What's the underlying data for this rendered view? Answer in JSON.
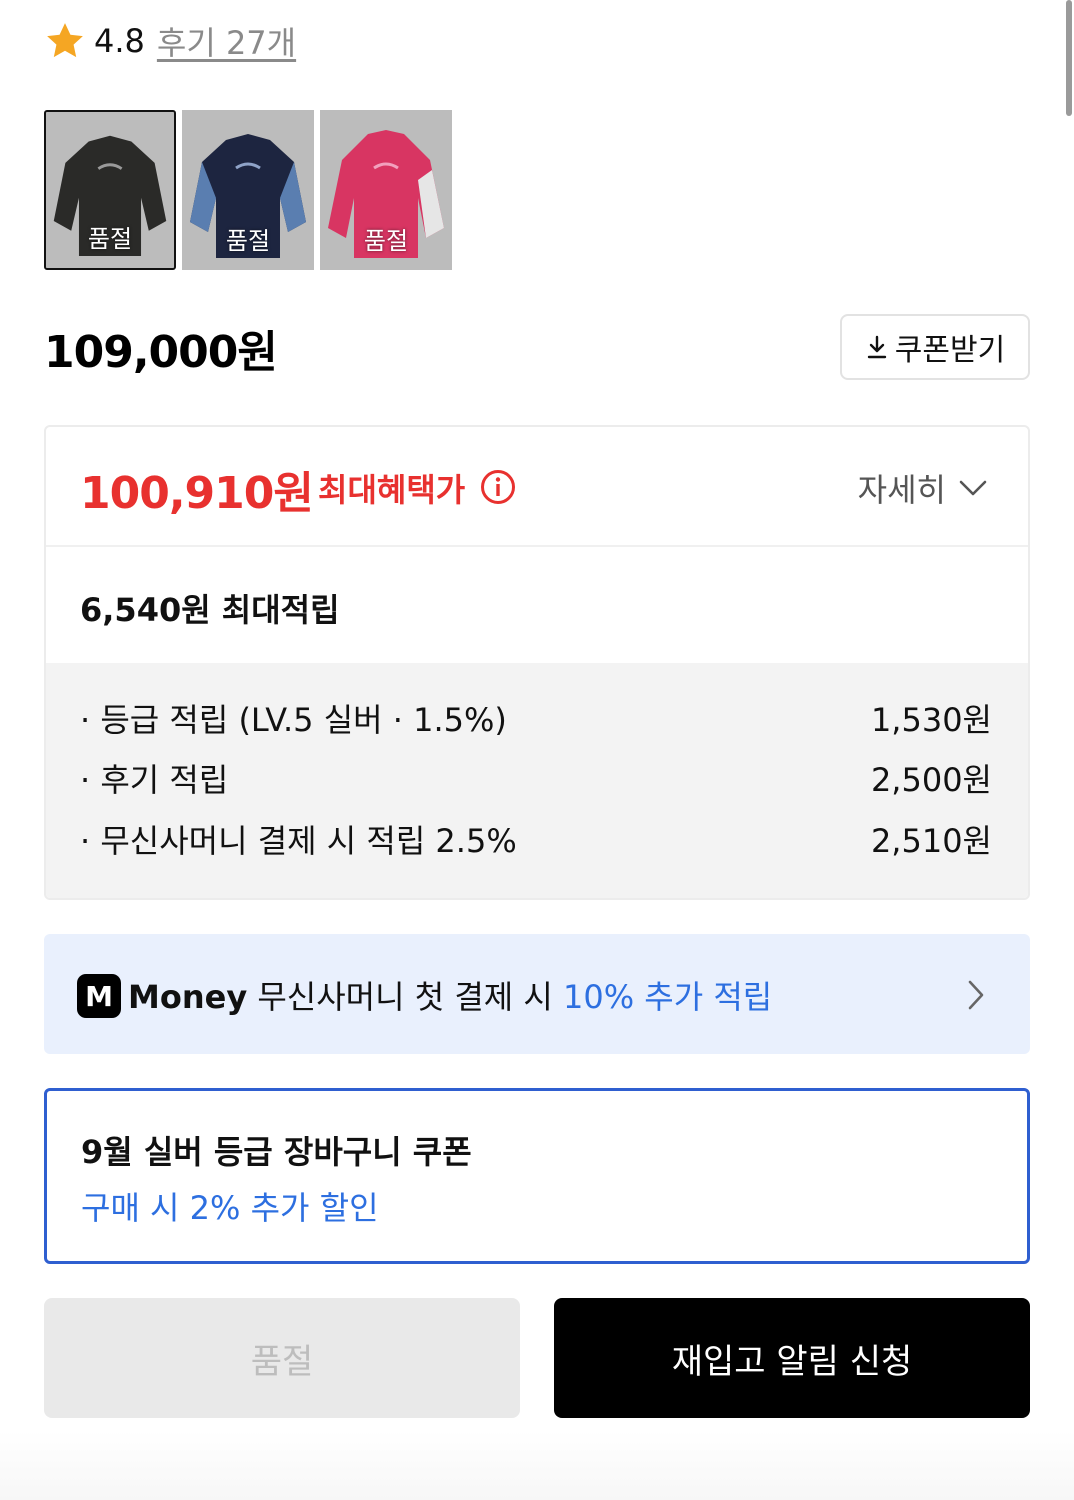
{
  "rating": {
    "score": "4.8",
    "review_link": "후기 27개",
    "star_color": "#f5a623"
  },
  "thumbnails": [
    {
      "label": "품절",
      "color": "black",
      "selected": true
    },
    {
      "label": "품절",
      "color": "navy",
      "selected": false
    },
    {
      "label": "품절",
      "color": "pink",
      "selected": false
    }
  ],
  "price": {
    "original": "109,000원",
    "coupon_button": "쿠폰받기",
    "coupon_icon": "download-icon"
  },
  "benefit": {
    "max_price": "100,910원",
    "max_label": "최대혜택가",
    "detail_toggle": "자세히",
    "points_title": "6,540원 최대적립",
    "rows": [
      {
        "label": "· 등급 적립 (LV.5 실버 · 1.5%)",
        "amount": "1,530원"
      },
      {
        "label": "· 후기 적립",
        "amount": "2,500원"
      },
      {
        "label": "· 무신사머니 결제 시 적립 2.5%",
        "amount": "2,510원"
      }
    ],
    "accent_color": "#e8312f"
  },
  "money_banner": {
    "logo": "M",
    "brand": "Money",
    "text": "무신사머니 첫 결제 시",
    "highlight": "10% 추가 적립",
    "highlight_color": "#2d6fe0"
  },
  "coupon_card": {
    "title": "9월 실버 등급 장바구니 쿠폰",
    "subtitle": "구매 시 2% 추가 할인",
    "border_color": "#2f5fd0"
  },
  "actions": {
    "soldout": "품절",
    "restock": "재입고 알림 신청"
  }
}
